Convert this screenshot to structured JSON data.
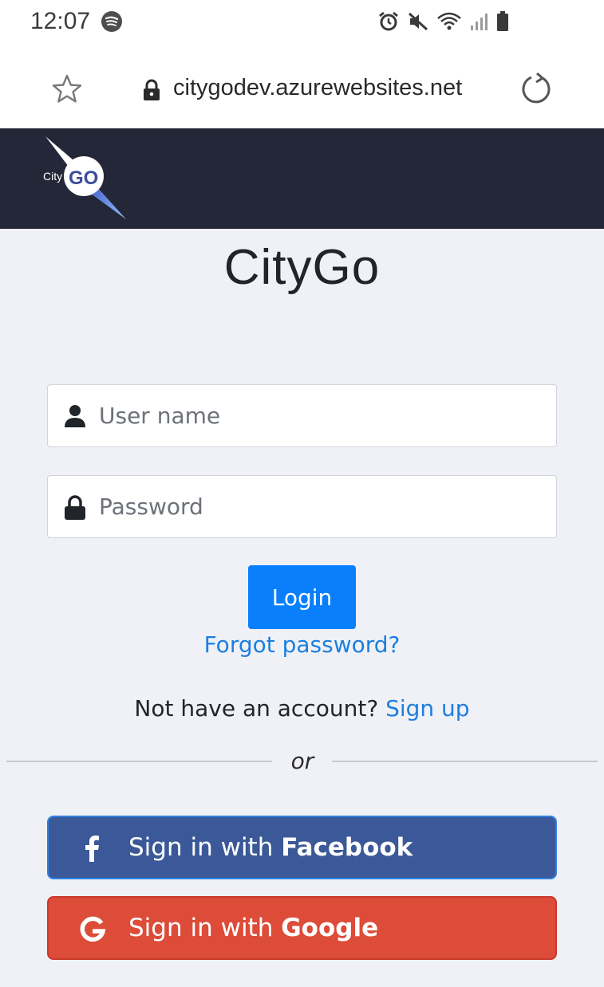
{
  "status_bar": {
    "time": "12:07",
    "icons": [
      "spotify-icon",
      "alarm-icon",
      "mute-icon",
      "wifi-icon",
      "signal-icon",
      "battery-icon"
    ]
  },
  "browser": {
    "url": "citygodev.azurewebsites.net",
    "icons": [
      "star-icon",
      "lock-icon",
      "reload-icon"
    ]
  },
  "navbar": {
    "logo_text_city": "City",
    "logo_text_go": "GO",
    "background": "#232738"
  },
  "page": {
    "title": "CityGo"
  },
  "form": {
    "username_placeholder": "User name",
    "password_placeholder": "Password",
    "login_label": "Login",
    "forgot_label": "Forgot password?",
    "signup_prompt": "Not have an account? ",
    "signup_link": "Sign up",
    "or_label": "or"
  },
  "social": {
    "facebook": {
      "prefix": "Sign in with ",
      "brand": "Facebook",
      "color": "#3b5998"
    },
    "google": {
      "prefix": "Sign in with ",
      "brand": "Google",
      "color": "#dd4b39"
    }
  },
  "colors": {
    "accent": "#0a7ffc",
    "link": "#1c7fdf",
    "background": "#f0f1f6"
  }
}
